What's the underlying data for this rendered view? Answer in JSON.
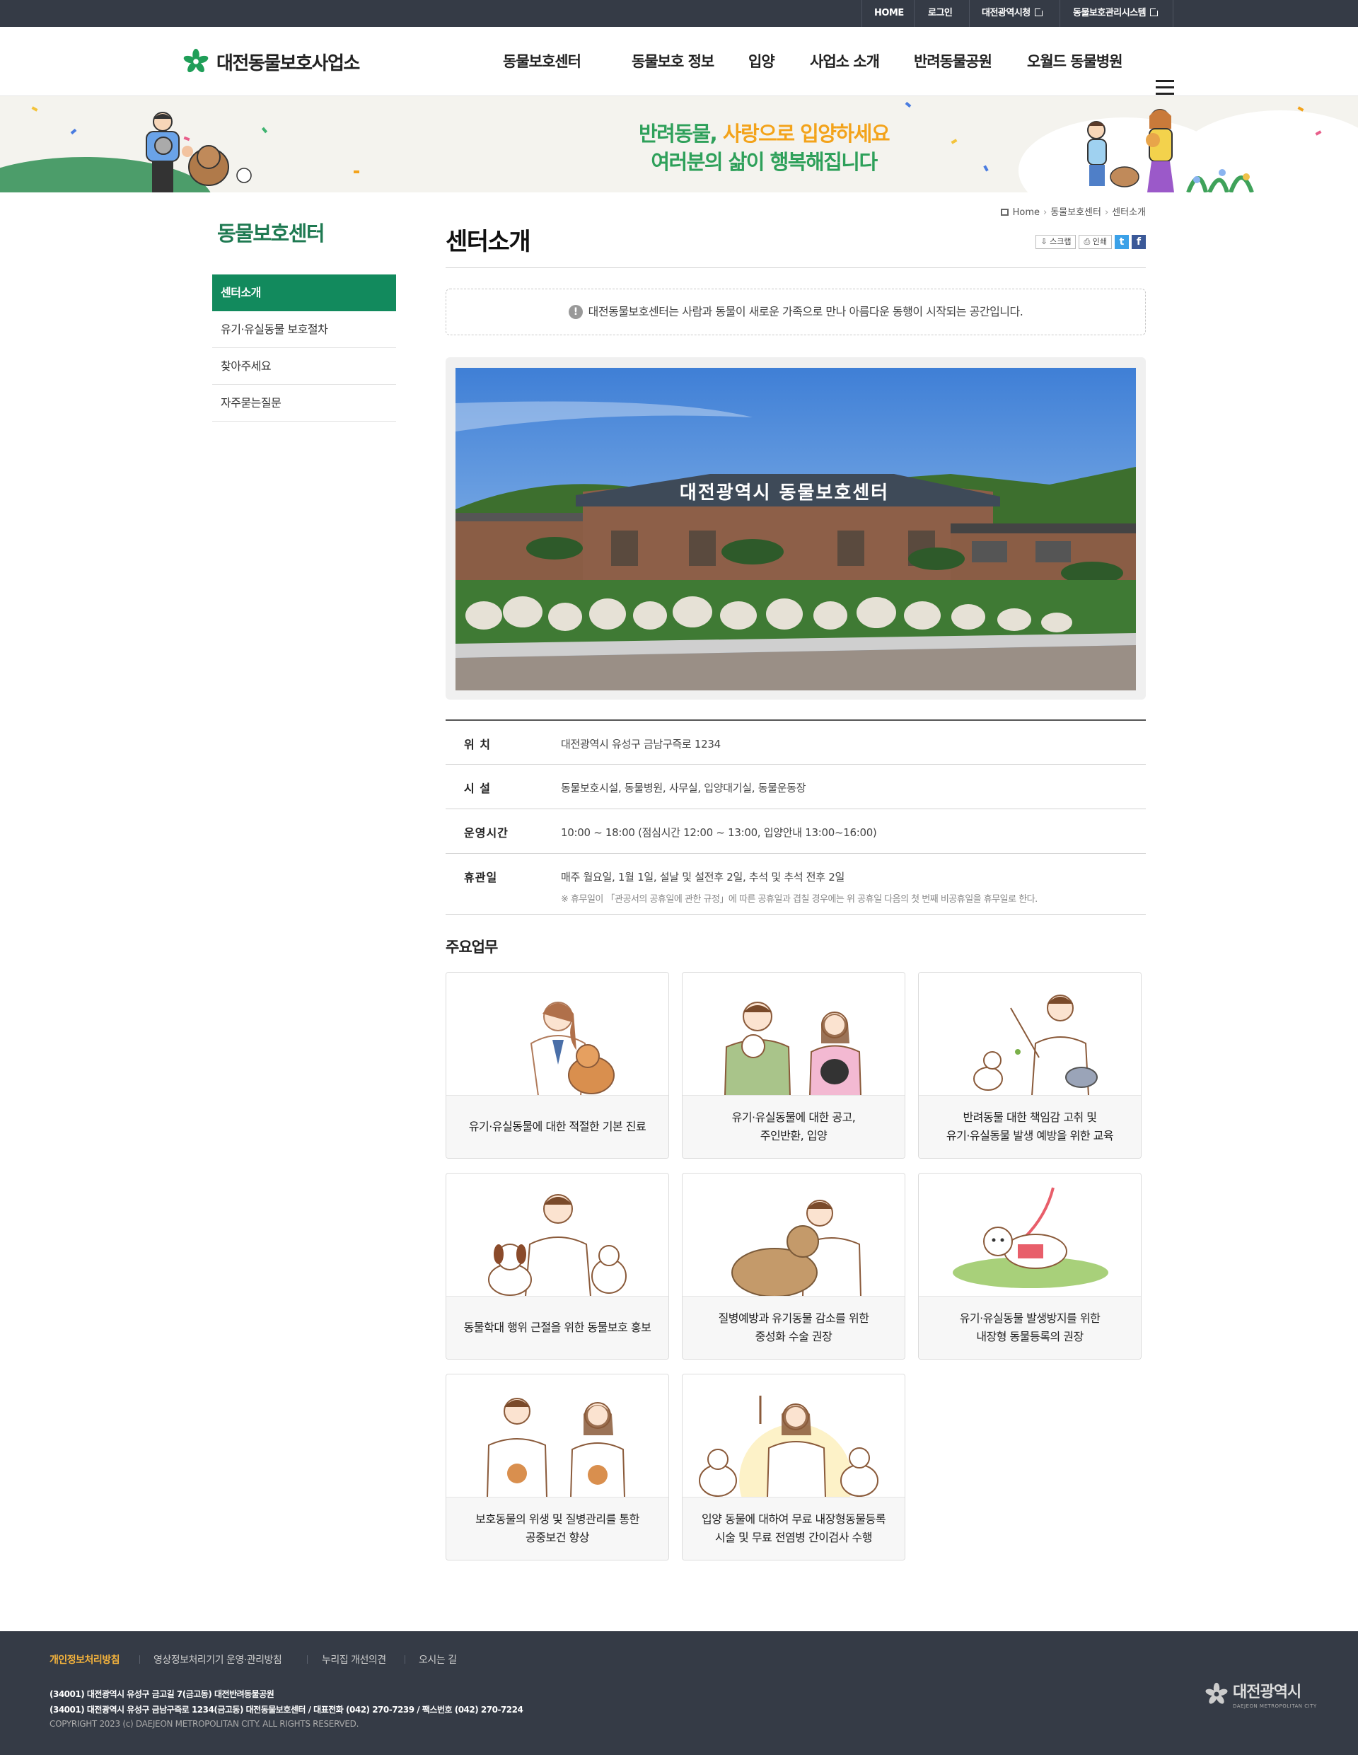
{
  "topbar": {
    "home": "HOME",
    "login": "로그인",
    "city_hall": "대전광역시청",
    "management": "동물보호관리시스템"
  },
  "header": {
    "logo_text": "대전동물보호사업소",
    "nav": [
      "동물보호센터",
      "동물보호 정보",
      "입양",
      "사업소 소개",
      "반려동물공원",
      "오월드 동물병원"
    ]
  },
  "banner": {
    "line1_green": "반려동물,",
    "line1_orange": "사랑으로 입양하세요",
    "line2": "여러분의 삶이 행복해집니다"
  },
  "sidebar": {
    "title": "동물보호센터",
    "items": [
      "센터소개",
      "유기·유실동물 보호절차",
      "찾아주세요",
      "자주묻는질문"
    ]
  },
  "breadcrumb": [
    "Home",
    "동물보호센터",
    "센터소개"
  ],
  "page_title": "센터소개",
  "tools": {
    "scrap": "스크랩",
    "print": "인쇄"
  },
  "notice": "대전동물보호센터는 사람과 동물이 새로운 가족으로 만나 아름다운 동행이 시작되는 공간입니다.",
  "photo_sign": "대전광역시 동물보호센터",
  "info": [
    {
      "label": "위 치",
      "value": "대전광역시 유성구 금남구즉로 1234",
      "note": ""
    },
    {
      "label": "시 설",
      "value": "동물보호시설, 동물병원, 사무실, 입양대기실, 동물운동장",
      "note": ""
    },
    {
      "label": "운영시간",
      "value": "10:00 ~ 18:00 (점심시간 12:00 ~ 13:00, 입양안내 13:00~16:00)",
      "note": ""
    },
    {
      "label": "휴관일",
      "value": "매주 월요일, 1월 1일, 설날 및 설전후 2일, 추석 및 추석 전후 2일",
      "note": "※ 휴무일이 「관공서의 공휴일에 관한 규정」에 따른 공휴일과 겹칠 경우에는 위 공휴일 다음의 첫 번째 비공휴일을 휴무일로 한다."
    }
  ],
  "duties": {
    "title": "주요업무",
    "cards": [
      "유기·유실동물에 대한 적절한 기본 진료",
      "유기·유실동물에 대한 공고,\n주인반환, 입양",
      "반려동물 대한 책임감 고취 및\n유기·유실동물 발생 예방을 위한 교육",
      "동물학대 행위 근절을 위한 동물보호 홍보",
      "질병예방과 유기동물 감소를 위한\n중성화 수술 권장",
      "유기·유실동물 발생방지를 위한\n내장형 동물등록의 권장",
      "보호동물의 위생 및 질병관리를 통한\n공중보건 향상",
      "입양 동물에 대하여 무료 내장형동물등록\n시술 및 무료 전염병 간이검사 수행"
    ]
  },
  "footer": {
    "links": [
      "개인정보처리방침",
      "영상정보처리기기 운영·관리방침",
      "누리집 개선의견",
      "오시는 길"
    ],
    "address1": "(34001) 대전광역시 유성구 금고길 7(금고동) 대전반려동물공원",
    "address2": "(34001) 대전광역시 유성구 금남구즉로 1234(금고동) 대전동물보호센터 / 대표전화 (042) 270-7239 / 팩스번호 (042) 270-7224",
    "copyright": "COPYRIGHT 2023 (c) DAEJEON METROPOLITAN CITY. ALL RIGHTS RESERVED.",
    "city_logo": "대전광역시",
    "city_logo_sub": "DAEJEON METROPOLITAN CITY"
  },
  "colors": {
    "brand_green": "#128a5d",
    "topbar": "#353b46",
    "banner_orange": "#f3a31b"
  }
}
